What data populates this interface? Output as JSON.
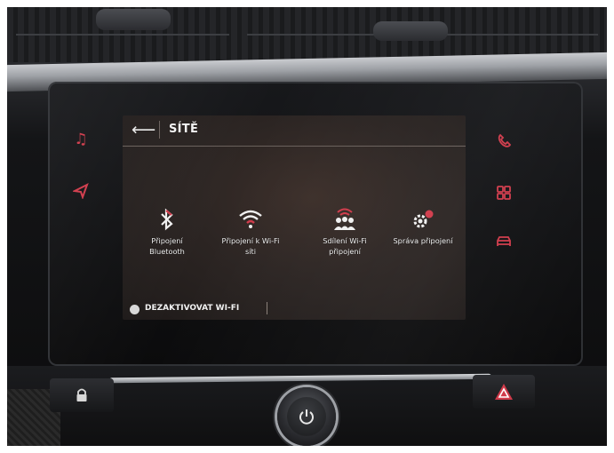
{
  "screen": {
    "title": "SÍTĚ",
    "back_icon": "back-arrow-icon",
    "tiles": [
      {
        "label_line1": "Připojení",
        "label_line2": "Bluetooth",
        "icon": "bluetooth-icon"
      },
      {
        "label_line1": "Připojení k Wi-Fi",
        "label_line2": "síti",
        "icon": "wifi-icon"
      },
      {
        "label_line1": "Sdílení Wi-Fi",
        "label_line2": "připojení",
        "icon": "wifi-sharing-icon"
      },
      {
        "label_line1": "Správa připojení",
        "label_line2": "",
        "icon": "connection-settings-icon"
      }
    ],
    "footer_toggle_label": "DEZAKTIVOVAT WI-FI"
  },
  "side_buttons_left": [
    {
      "icon": "music-note-icon"
    },
    {
      "icon": "navigation-icon"
    }
  ],
  "side_buttons_right": [
    {
      "icon": "phone-icon"
    },
    {
      "icon": "apps-grid-icon"
    },
    {
      "icon": "car-icon"
    }
  ],
  "console": {
    "lock_icon": "lock-icon",
    "power_icon": "power-icon",
    "hazard_icon": "hazard-icon"
  },
  "colors": {
    "accent": "#d03a4a",
    "screen_bg": "#2c2523",
    "text": "#f2f2f2"
  }
}
